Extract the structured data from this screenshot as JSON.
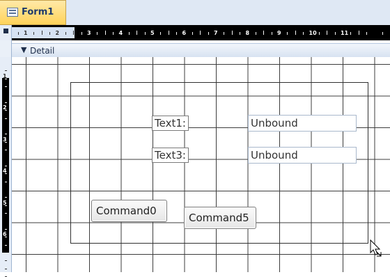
{
  "window": {
    "tab_title": "Form1"
  },
  "ruler": {
    "h_numbers": [
      "1",
      "2",
      "3",
      "4",
      "5",
      "6",
      "7",
      "8",
      "9",
      "10",
      "11"
    ],
    "v_numbers": [
      "1",
      "2",
      "3",
      "4",
      "5",
      "6"
    ]
  },
  "section": {
    "label": "Detail"
  },
  "controls": {
    "labels": [
      "Text1:",
      "Text3:"
    ],
    "textboxes": [
      "Unbound",
      "Unbound"
    ],
    "buttons": [
      "Command0",
      "Command5"
    ]
  },
  "icons": {
    "tab": "form-icon",
    "section": "section-collapse-icon",
    "cursor": "resize-cursor-icon"
  }
}
